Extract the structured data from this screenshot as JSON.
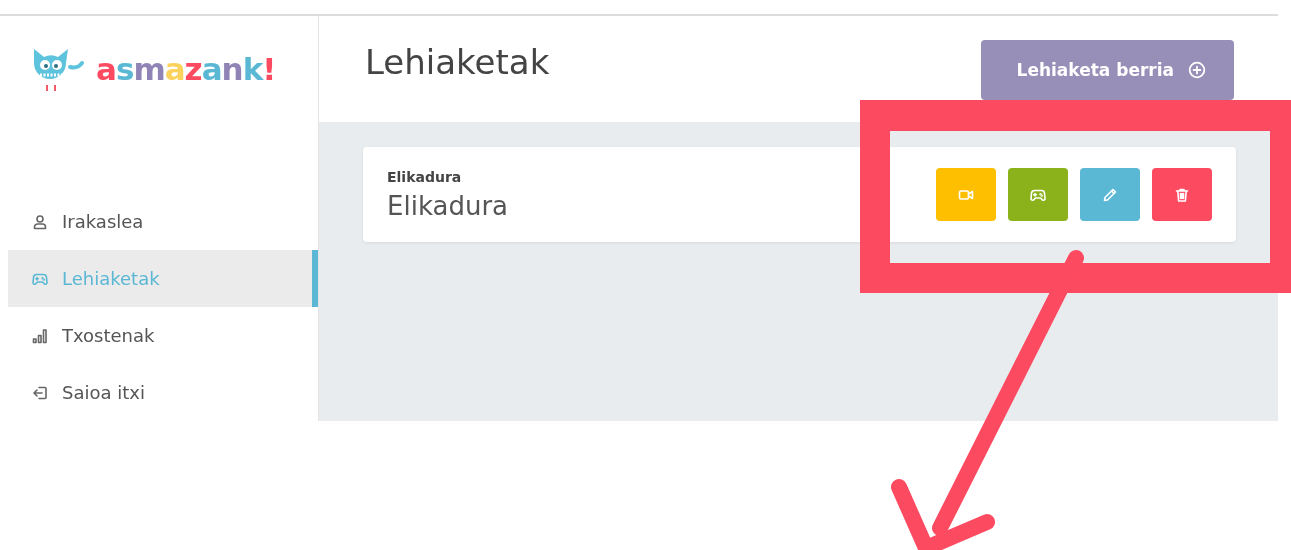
{
  "logo": {
    "text": "asmazank!"
  },
  "sidebar": {
    "items": [
      {
        "label": "Irakaslea",
        "kind": "user",
        "selected": false
      },
      {
        "label": "Lehiaketak",
        "kind": "gamepad",
        "selected": true
      },
      {
        "label": "Txostenak",
        "kind": "chart",
        "selected": false
      },
      {
        "label": "Saioa itxi",
        "kind": "logout",
        "selected": false
      }
    ]
  },
  "header": {
    "title": "Lehiaketak",
    "new_button": "Lehiaketa berria"
  },
  "contests": [
    {
      "category": "Elikadura",
      "title": "Elikadura",
      "actions": [
        {
          "kind": "video",
          "color": "#fdbf00"
        },
        {
          "kind": "play",
          "color": "#8cb21b"
        },
        {
          "kind": "edit",
          "color": "#5bb8d4"
        },
        {
          "kind": "delete",
          "color": "#fc4a60"
        }
      ]
    }
  ],
  "annotation": {
    "highlight_frame": true,
    "arrow": true
  }
}
